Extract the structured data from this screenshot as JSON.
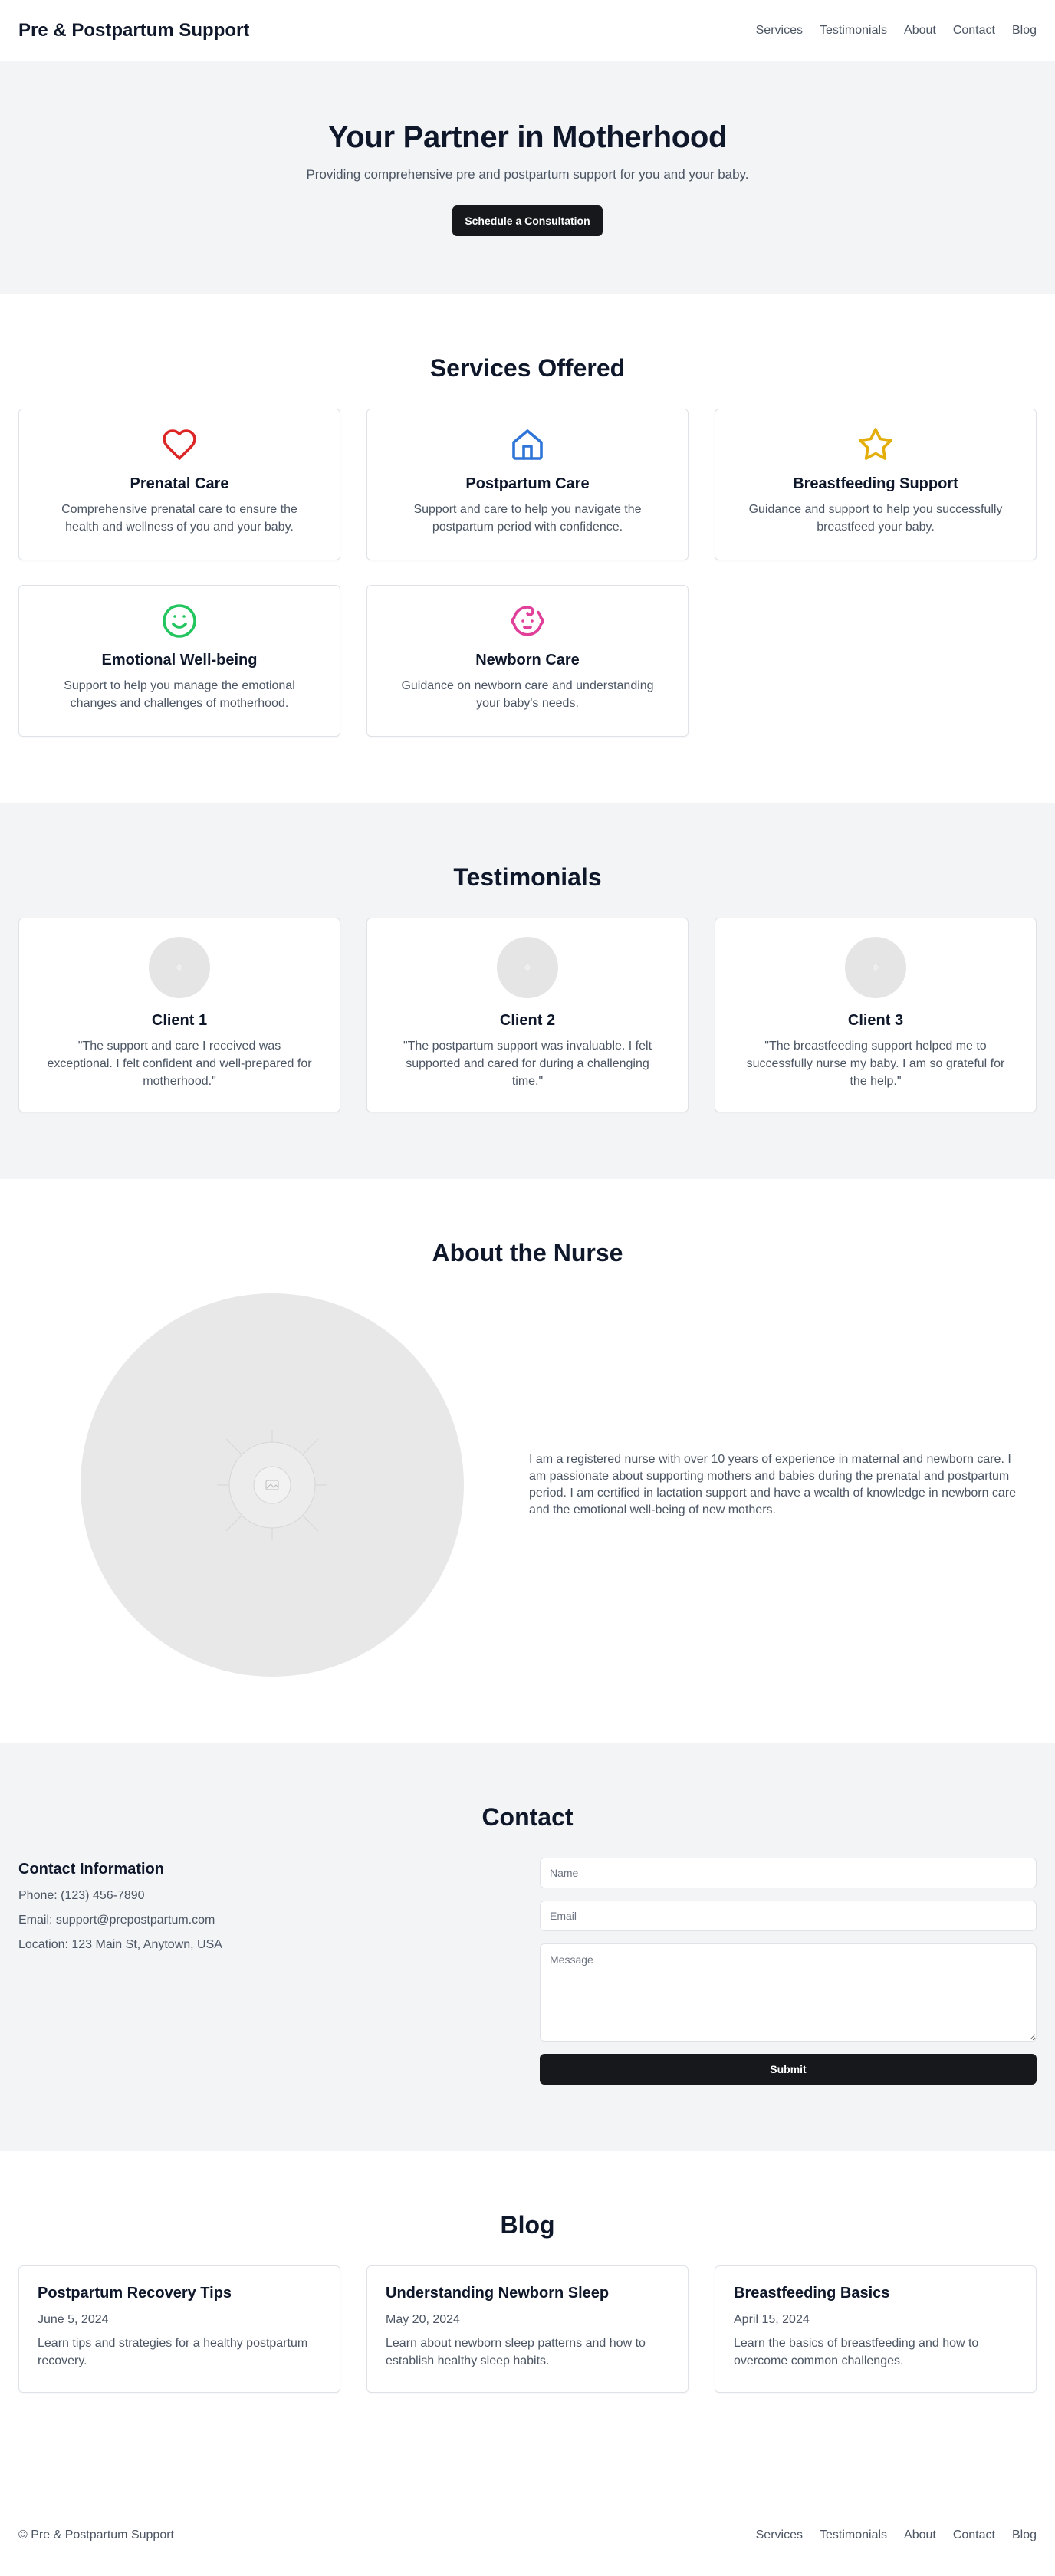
{
  "header": {
    "brand": "Pre & Postpartum Support",
    "nav": [
      "Services",
      "Testimonials",
      "About",
      "Contact",
      "Blog"
    ]
  },
  "hero": {
    "title": "Your Partner in Motherhood",
    "subtitle": "Providing comprehensive pre and postpartum support for you and your baby.",
    "cta": "Schedule a Consultation"
  },
  "services": {
    "title": "Services Offered",
    "items": [
      {
        "icon": "heart-icon",
        "color": "#dc2626",
        "title": "Prenatal Care",
        "text": "Comprehensive prenatal care to ensure the health and wellness of you and your baby."
      },
      {
        "icon": "home-icon",
        "color": "#2f74d8",
        "title": "Postpartum Care",
        "text": "Support and care to help you navigate the postpartum period with confidence."
      },
      {
        "icon": "star-icon",
        "color": "#e3ae0a",
        "title": "Breastfeeding Support",
        "text": "Guidance and support to help you successfully breastfeed your baby."
      },
      {
        "icon": "smile-icon",
        "color": "#22c55e",
        "title": "Emotional Well-being",
        "text": "Support to help you manage the emotional changes and challenges of motherhood."
      },
      {
        "icon": "baby-icon",
        "color": "#e0409a",
        "title": "Newborn Care",
        "text": "Guidance on newborn care and understanding your baby's needs."
      }
    ]
  },
  "testimonials": {
    "title": "Testimonials",
    "items": [
      {
        "name": "Client 1",
        "quote": "\"The support and care I received was exceptional. I felt confident and well-prepared for motherhood.\""
      },
      {
        "name": "Client 2",
        "quote": "\"The postpartum support was invaluable. I felt supported and cared for during a challenging time.\""
      },
      {
        "name": "Client 3",
        "quote": "\"The breastfeeding support helped me to successfully nurse my baby. I am so grateful for the help.\""
      }
    ]
  },
  "about": {
    "title": "About the Nurse",
    "text": "I am a registered nurse with over 10 years of experience in maternal and newborn care. I am passionate about supporting mothers and babies during the prenatal and postpartum period. I am certified in lactation support and have a wealth of knowledge in newborn care and the emotional well-being of new mothers."
  },
  "contact": {
    "title": "Contact",
    "info_title": "Contact Information",
    "phone": "Phone: (123) 456-7890",
    "email": "Email: support@prepostpartum.com",
    "location": "Location: 123 Main St, Anytown, USA",
    "form": {
      "name_placeholder": "Name",
      "email_placeholder": "Email",
      "message_placeholder": "Message",
      "submit": "Submit"
    }
  },
  "blog": {
    "title": "Blog",
    "posts": [
      {
        "title": "Postpartum Recovery Tips",
        "date": "June 5, 2024",
        "excerpt": "Learn tips and strategies for a healthy postpartum recovery."
      },
      {
        "title": "Understanding Newborn Sleep",
        "date": "May 20, 2024",
        "excerpt": "Learn about newborn sleep patterns and how to establish healthy sleep habits."
      },
      {
        "title": "Breastfeeding Basics",
        "date": "April 15, 2024",
        "excerpt": "Learn the basics of breastfeeding and how to overcome common challenges."
      }
    ]
  },
  "footer": {
    "copyright": "© Pre & Postpartum Support",
    "nav": [
      "Services",
      "Testimonials",
      "About",
      "Contact",
      "Blog"
    ]
  }
}
